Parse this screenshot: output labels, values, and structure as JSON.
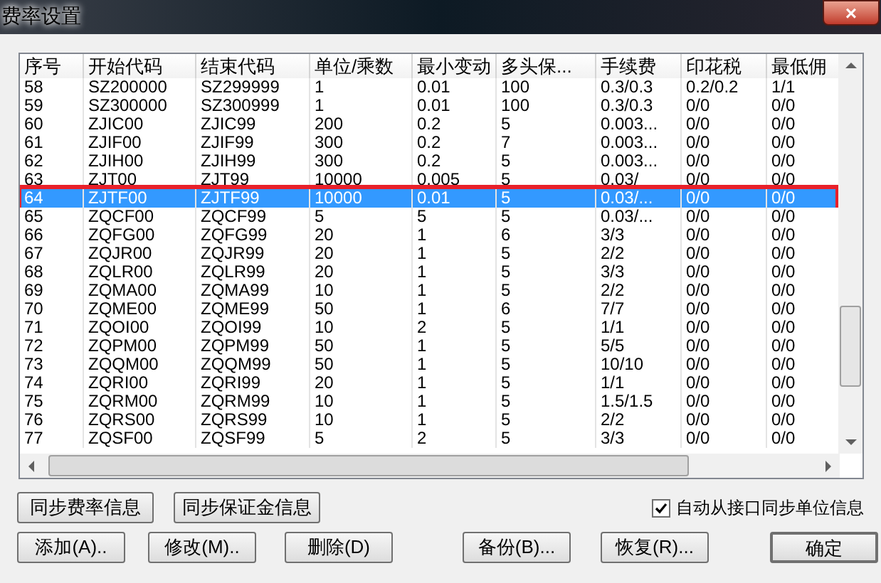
{
  "window": {
    "title": "费率设置",
    "close": "×"
  },
  "table": {
    "columns": [
      "序号",
      "开始代码",
      "结束代码",
      "单位/乘数",
      "最小变动",
      "多头保...",
      "手续费",
      "印花税",
      "最低佣"
    ],
    "rows": [
      {
        "cells": [
          "58",
          "SZ200000",
          "SZ299999",
          "1",
          "0.01",
          "100",
          "0.3/0.3",
          "0.2/0.2",
          "1/1"
        ],
        "selected": false,
        "outlined": false
      },
      {
        "cells": [
          "59",
          "SZ300000",
          "SZ300999",
          "1",
          "0.01",
          "100",
          "0.3/0.3",
          "0/0",
          "0/0"
        ],
        "selected": false,
        "outlined": false
      },
      {
        "cells": [
          "60",
          "ZJIC00",
          "ZJIC99",
          "200",
          "0.2",
          "5",
          "0.003...",
          "0/0",
          "0/0"
        ],
        "selected": false,
        "outlined": false
      },
      {
        "cells": [
          "61",
          "ZJIF00",
          "ZJIF99",
          "300",
          "0.2",
          "7",
          "0.003...",
          "0/0",
          "0/0"
        ],
        "selected": false,
        "outlined": false
      },
      {
        "cells": [
          "62",
          "ZJIH00",
          "ZJIH99",
          "300",
          "0.2",
          "5",
          "0.003...",
          "0/0",
          "0/0"
        ],
        "selected": false,
        "outlined": false
      },
      {
        "cells": [
          "63",
          "ZJT00",
          "ZJT99",
          "10000",
          "0.005",
          "5",
          "0.03/",
          "0/0",
          "0/0"
        ],
        "selected": false,
        "outlined": false
      },
      {
        "cells": [
          "64",
          "ZJTF00",
          "ZJTF99",
          "10000",
          "0.01",
          "5",
          "0.03/...",
          "0/0",
          "0/0"
        ],
        "selected": true,
        "outlined": true
      },
      {
        "cells": [
          "65",
          "ZQCF00",
          "ZQCF99",
          "5",
          "5",
          "5",
          "0.03/...",
          "0/0",
          "0/0"
        ],
        "selected": false,
        "outlined": false
      },
      {
        "cells": [
          "66",
          "ZQFG00",
          "ZQFG99",
          "20",
          "1",
          "6",
          "3/3",
          "0/0",
          "0/0"
        ],
        "selected": false,
        "outlined": false
      },
      {
        "cells": [
          "67",
          "ZQJR00",
          "ZQJR99",
          "20",
          "1",
          "5",
          "2/2",
          "0/0",
          "0/0"
        ],
        "selected": false,
        "outlined": false
      },
      {
        "cells": [
          "68",
          "ZQLR00",
          "ZQLR99",
          "20",
          "1",
          "5",
          "3/3",
          "0/0",
          "0/0"
        ],
        "selected": false,
        "outlined": false
      },
      {
        "cells": [
          "69",
          "ZQMA00",
          "ZQMA99",
          "10",
          "1",
          "5",
          "2/2",
          "0/0",
          "0/0"
        ],
        "selected": false,
        "outlined": false
      },
      {
        "cells": [
          "70",
          "ZQME00",
          "ZQME99",
          "50",
          "1",
          "6",
          "7/7",
          "0/0",
          "0/0"
        ],
        "selected": false,
        "outlined": false
      },
      {
        "cells": [
          "71",
          "ZQOI00",
          "ZQOI99",
          "10",
          "2",
          "5",
          "1/1",
          "0/0",
          "0/0"
        ],
        "selected": false,
        "outlined": false
      },
      {
        "cells": [
          "72",
          "ZQPM00",
          "ZQPM99",
          "50",
          "1",
          "5",
          "5/5",
          "0/0",
          "0/0"
        ],
        "selected": false,
        "outlined": false
      },
      {
        "cells": [
          "73",
          "ZQQM00",
          "ZQQM99",
          "50",
          "1",
          "5",
          "10/10",
          "0/0",
          "0/0"
        ],
        "selected": false,
        "outlined": false
      },
      {
        "cells": [
          "74",
          "ZQRI00",
          "ZQRI99",
          "20",
          "1",
          "5",
          "1/1",
          "0/0",
          "0/0"
        ],
        "selected": false,
        "outlined": false
      },
      {
        "cells": [
          "75",
          "ZQRM00",
          "ZQRM99",
          "10",
          "1",
          "5",
          "1.5/1.5",
          "0/0",
          "0/0"
        ],
        "selected": false,
        "outlined": false
      },
      {
        "cells": [
          "76",
          "ZQRS00",
          "ZQRS99",
          "10",
          "1",
          "5",
          "2/2",
          "0/0",
          "0/0"
        ],
        "selected": false,
        "outlined": false
      },
      {
        "cells": [
          "77",
          "ZQSF00",
          "ZQSF99",
          "5",
          "2",
          "5",
          "3/3",
          "0/0",
          "0/0"
        ],
        "selected": false,
        "outlined": false
      }
    ]
  },
  "sync_buttons": [
    "同步费率信息",
    "同步保证金信息"
  ],
  "auto_sync": {
    "label": "自动从接口同步单位信息",
    "checked": true
  },
  "action_buttons": [
    {
      "label": "添加(A)..",
      "default": false
    },
    {
      "label": "修改(M)..",
      "default": false
    },
    {
      "label": "删除(D)",
      "default": false
    },
    {
      "label": "备份(B)...",
      "default": false
    },
    {
      "label": "恢复(R)...",
      "default": false
    },
    {
      "label": "确定",
      "default": true
    }
  ]
}
